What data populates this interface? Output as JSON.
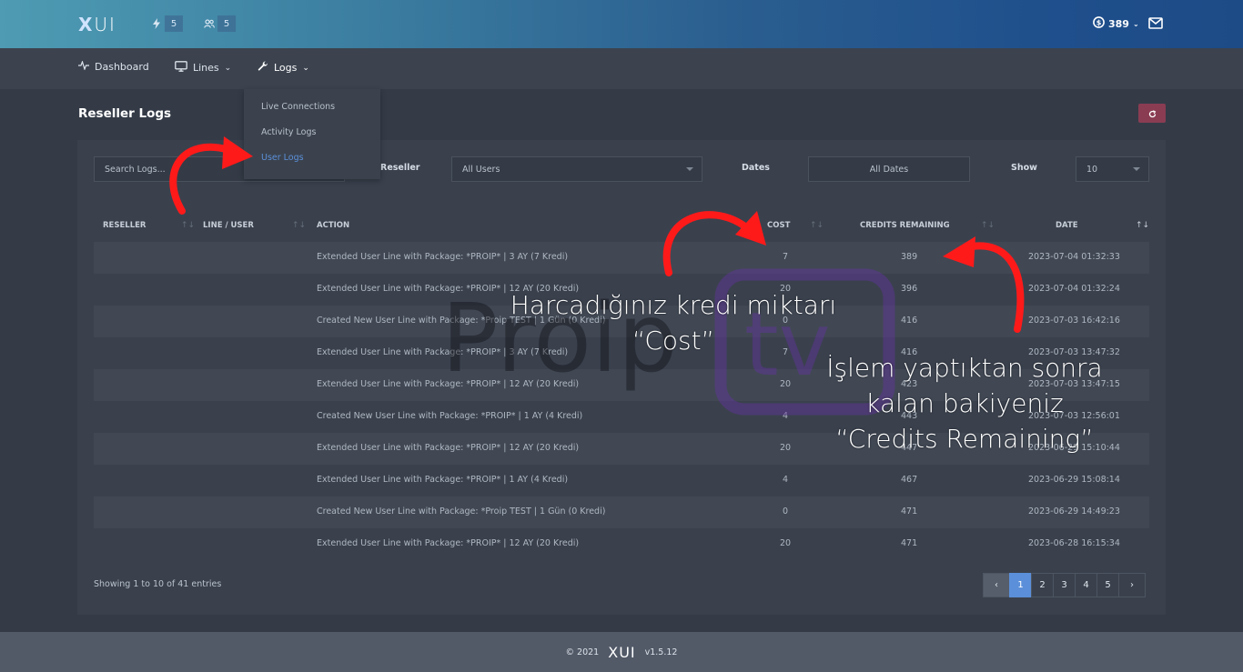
{
  "header": {
    "logo_x": "X",
    "logo_ui": "UI",
    "stat1_value": "5",
    "stat2_value": "5",
    "credits": "389"
  },
  "nav": {
    "dashboard": "Dashboard",
    "lines": "Lines",
    "logs": "Logs"
  },
  "dropdown": {
    "items": [
      "Live Connections",
      "Activity Logs",
      "User Logs"
    ]
  },
  "page": {
    "title": "Reseller Logs"
  },
  "filters": {
    "search_placeholder": "Search Logs...",
    "reseller_label": "Reseller",
    "reseller_value": "All Users",
    "dates_label": "Dates",
    "dates_value": "All Dates",
    "show_label": "Show",
    "show_value": "10"
  },
  "table": {
    "headers": [
      "RESELLER",
      "LINE / USER",
      "ACTION",
      "COST",
      "CREDITS REMAINING",
      "DATE"
    ],
    "rows": [
      {
        "action": "Extended User Line with Package: *PROIP* | 3 AY (7 Kredi)",
        "cost": "7",
        "credits": "389",
        "date": "2023-07-04 01:32:33"
      },
      {
        "action": "Extended User Line with Package: *PROIP* | 12 AY (20 Kredi)",
        "cost": "20",
        "credits": "396",
        "date": "2023-07-04 01:32:24"
      },
      {
        "action": "Created New User Line with Package: *Proip TEST | 1 Gün (0 Kredi)",
        "cost": "0",
        "credits": "416",
        "date": "2023-07-03 16:42:16"
      },
      {
        "action": "Extended User Line with Package: *PROIP* | 3 AY (7 Kredi)",
        "cost": "7",
        "credits": "416",
        "date": "2023-07-03 13:47:32"
      },
      {
        "action": "Extended User Line with Package: *PROIP* | 12 AY (20 Kredi)",
        "cost": "20",
        "credits": "423",
        "date": "2023-07-03 13:47:15"
      },
      {
        "action": "Created New User Line with Package: *PROIP* | 1 AY (4 Kredi)",
        "cost": "4",
        "credits": "443",
        "date": "2023-07-03 12:56:01"
      },
      {
        "action": "Extended User Line with Package: *PROIP* | 12 AY (20 Kredi)",
        "cost": "20",
        "credits": "447",
        "date": "2023-06-29 15:10:44"
      },
      {
        "action": "Extended User Line with Package: *PROIP* | 1 AY (4 Kredi)",
        "cost": "4",
        "credits": "467",
        "date": "2023-06-29 15:08:14"
      },
      {
        "action": "Created New User Line with Package: *Proip TEST | 1 Gün (0 Kredi)",
        "cost": "0",
        "credits": "471",
        "date": "2023-06-29 14:49:23"
      },
      {
        "action": "Extended User Line with Package: *PROIP* | 12 AY (20 Kredi)",
        "cost": "20",
        "credits": "471",
        "date": "2023-06-28 16:15:34"
      }
    ]
  },
  "pagination": {
    "showing": "Showing 1 to 10 of 41 entries",
    "prev": "‹",
    "pages": [
      "1",
      "2",
      "3",
      "4",
      "5"
    ],
    "next": "›"
  },
  "footer": {
    "copyright": "© 2021",
    "logo": "XUI",
    "version": "v1.5.12"
  },
  "annotations": {
    "cost_line1": "Harcadığınız kredi miktarı",
    "cost_line2": "“Cost”",
    "credits_line1": "İşlem yaptıktan sonra",
    "credits_line2": "kalan bakiyeniz",
    "credits_line3": "“Credits Remaining”"
  },
  "watermark": {
    "text1": "Proip",
    "text2": "tv"
  },
  "colors": {
    "accent": "#5b8fd9",
    "refresh": "#8a3c53",
    "arrow": "#ff1a1a"
  }
}
